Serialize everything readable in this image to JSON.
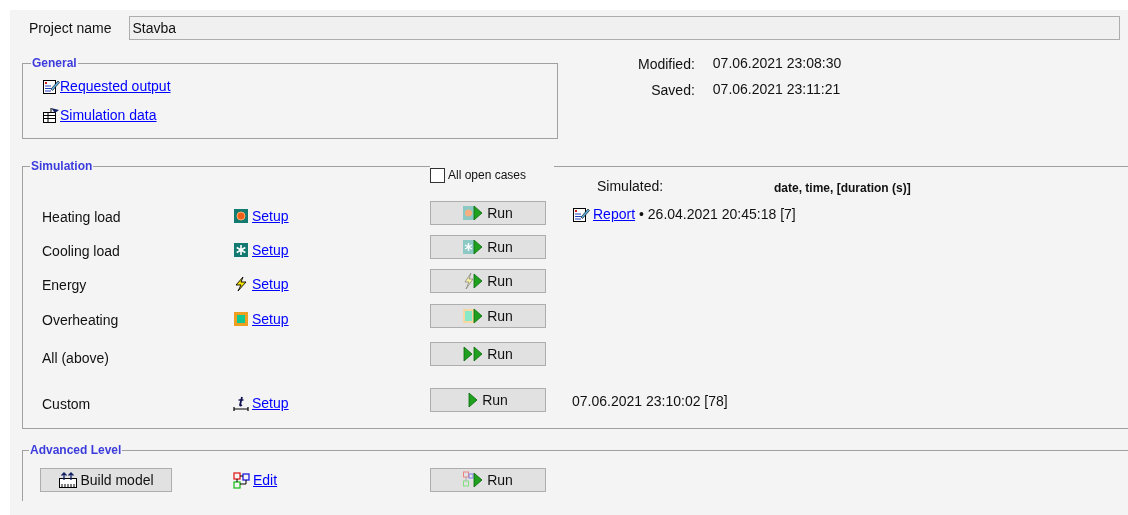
{
  "project": {
    "label": "Project name",
    "value": "Stavba"
  },
  "general": {
    "title": "General",
    "links": [
      {
        "kind": "output",
        "label": "Requested output"
      },
      {
        "kind": "data",
        "label": "Simulation data"
      }
    ]
  },
  "info": [
    {
      "label": "Modified:",
      "value": "07.06.2021 23:08:30"
    },
    {
      "label": "Saved:",
      "value": "07.06.2021 23:11:21"
    }
  ],
  "simulation": {
    "title": "Simulation",
    "all_open_cases": {
      "label": "All open cases",
      "checked": false
    },
    "simulated_label": "Simulated:",
    "columns_hint": "date, time, [duration (s)]",
    "rows": [
      {
        "kind": "heating",
        "label": "Heating load",
        "setup": "Setup",
        "run": "Run",
        "report": "Report",
        "result": "• 26.04.2021 20:45:18 [7]"
      },
      {
        "kind": "cooling",
        "label": "Cooling load",
        "setup": "Setup",
        "run": "Run"
      },
      {
        "kind": "energy",
        "label": "Energy",
        "setup": "Setup",
        "run": "Run"
      },
      {
        "kind": "overheating",
        "label": "Overheating",
        "setup": "Setup",
        "run": "Run"
      },
      {
        "kind": "all",
        "label": "All (above)",
        "run": "Run"
      },
      {
        "kind": "custom",
        "label": "Custom",
        "setup": "Setup",
        "run": "Run",
        "result": "07.06.2021 23:10:02 [78]"
      }
    ]
  },
  "advanced": {
    "title": "Advanced Level",
    "build_button": "Build model",
    "edit_link": "Edit",
    "run_button": "Run"
  }
}
